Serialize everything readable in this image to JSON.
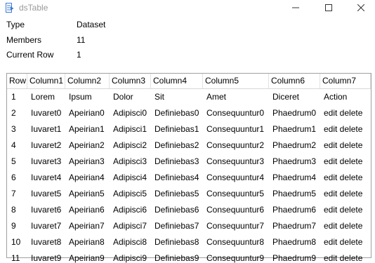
{
  "window": {
    "title": "dsTable"
  },
  "info": {
    "type_label": "Type",
    "type_value": "Dataset",
    "members_label": "Members",
    "members_value": "11",
    "current_row_label": "Current Row",
    "current_row_value": "1"
  },
  "table": {
    "headers": [
      "Row",
      "Column1",
      "Column2",
      "Column3",
      "Column4",
      "Column5",
      "Column6",
      "Column7"
    ],
    "rows": [
      [
        "1",
        "Lorem",
        "Ipsum",
        "Dolor",
        "Sit",
        "Amet",
        "Diceret",
        "Action"
      ],
      [
        "2",
        "Iuvaret0",
        "Apeirian0",
        "Adipisci0",
        "Definiebas0",
        "Consequuntur0",
        "Phaedrum0",
        "edit delete"
      ],
      [
        "3",
        "Iuvaret1",
        "Apeirian1",
        "Adipisci1",
        "Definiebas1",
        "Consequuntur1",
        "Phaedrum1",
        "edit delete"
      ],
      [
        "4",
        "Iuvaret2",
        "Apeirian2",
        "Adipisci2",
        "Definiebas2",
        "Consequuntur2",
        "Phaedrum2",
        "edit delete"
      ],
      [
        "5",
        "Iuvaret3",
        "Apeirian3",
        "Adipisci3",
        "Definiebas3",
        "Consequuntur3",
        "Phaedrum3",
        "edit delete"
      ],
      [
        "6",
        "Iuvaret4",
        "Apeirian4",
        "Adipisci4",
        "Definiebas4",
        "Consequuntur4",
        "Phaedrum4",
        "edit delete"
      ],
      [
        "7",
        "Iuvaret5",
        "Apeirian5",
        "Adipisci5",
        "Definiebas5",
        "Consequuntur5",
        "Phaedrum5",
        "edit delete"
      ],
      [
        "8",
        "Iuvaret6",
        "Apeirian6",
        "Adipisci6",
        "Definiebas6",
        "Consequuntur6",
        "Phaedrum6",
        "edit delete"
      ],
      [
        "9",
        "Iuvaret7",
        "Apeirian7",
        "Adipisci7",
        "Definiebas7",
        "Consequuntur7",
        "Phaedrum7",
        "edit delete"
      ],
      [
        "10",
        "Iuvaret8",
        "Apeirian8",
        "Adipisci8",
        "Definiebas8",
        "Consequuntur8",
        "Phaedrum8",
        "edit delete"
      ],
      [
        "11",
        "Iuvaret9",
        "Apeirian9",
        "Adipisci9",
        "Definiebas9",
        "Consequuntur9",
        "Phaedrum9",
        "edit delete"
      ]
    ]
  },
  "colors": {
    "title_text": "#9a9a9a",
    "grid_border": "#a0a0a0",
    "icon_blue": "#3b7bd4"
  }
}
